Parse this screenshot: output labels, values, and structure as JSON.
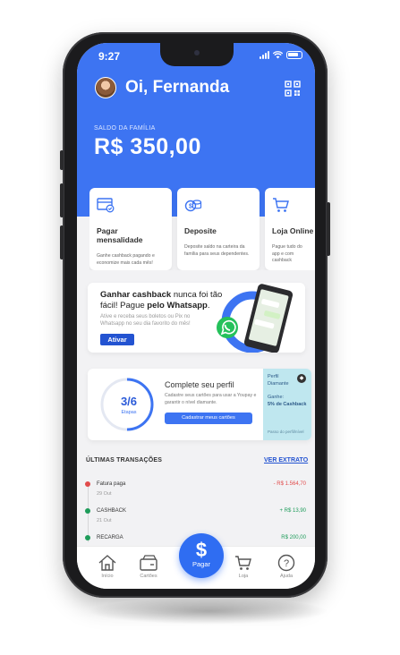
{
  "status": {
    "time": "9:27"
  },
  "header": {
    "greeting": "Oi, Fernanda"
  },
  "balance": {
    "label": "SALDO DA FAMÍLIA",
    "value": "R$ 350,00"
  },
  "cards": [
    {
      "title": "Pagar mensalidade",
      "desc": "Ganhe cashback pagando e economize mais cada mês!",
      "icon": "invoice-icon"
    },
    {
      "title": "Deposite",
      "desc": "Deposite saldo na carteira da família para seus dependentes.",
      "icon": "coins-icon"
    },
    {
      "title": "Loja Online",
      "desc": "Pague tudo do app e com cashback",
      "icon": "cart-icon"
    }
  ],
  "promo": {
    "headline_pre": "Ganhar cashback",
    "headline_mid": " nunca foi tão fácil! Pague ",
    "headline_bold": "pelo Whatsapp",
    "headline_end": ".",
    "sub": "Ative e receba seus boletos ou Pix no Whatsapp no seu dia favorito do mês!",
    "button": "Ativar"
  },
  "profile": {
    "progress": "3/6",
    "steps_label": "Etapas",
    "title": "Complete seu perfil",
    "desc": "Cadastre seus cartões para usar a Youpay e garantir o nível diamante.",
    "button": "Cadastrar meus cartões",
    "tier_label": "Perfil",
    "tier_name": "Diamante",
    "gain_label": "Ganhe:",
    "gain_value": "5% de Cashback",
    "next_label": "Passo do perfil/nível"
  },
  "transactions": {
    "title": "ÚLTIMAS TRANSAÇÕES",
    "link": "VER EXTRATO",
    "items": [
      {
        "name": "Fatura paga",
        "date": "29 Out",
        "amount": "- R$ 1.564,70",
        "color": "#e14b4b"
      },
      {
        "name": "CASHBACK",
        "date": "21 Out",
        "amount": "+ R$ 13,90",
        "color": "#1e9c5a"
      },
      {
        "name": "RECARGA",
        "date": "",
        "amount": "R$ 200,00",
        "color": "#1e9c5a"
      }
    ]
  },
  "nav": {
    "home": "Início",
    "cards": "Cartões",
    "pay": "Pagar",
    "store": "Loja",
    "help": "Ajuda"
  },
  "colors": {
    "primary": "#3d74f2",
    "accent": "#2353d1",
    "diamond": "#bfe7ef"
  }
}
